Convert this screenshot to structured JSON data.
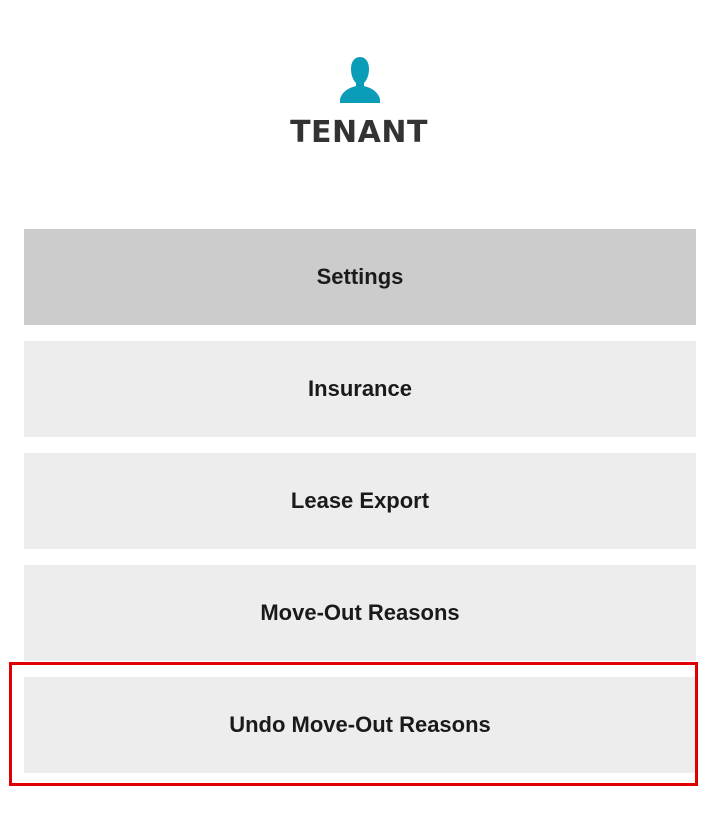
{
  "header": {
    "icon": "user-icon",
    "icon_color": "#0b9cb8",
    "title": "TENANT"
  },
  "menu": {
    "items": [
      {
        "label": "Settings",
        "active": true
      },
      {
        "label": "Insurance",
        "active": false
      },
      {
        "label": "Lease Export",
        "active": false
      },
      {
        "label": "Move-Out Reasons",
        "active": false
      },
      {
        "label": "Undo Move-Out Reasons",
        "active": false
      }
    ]
  },
  "highlight": {
    "target": "Undo Move-Out Reasons",
    "color": "#e00000"
  },
  "colors": {
    "active_item_bg": "#cccccc",
    "item_bg": "#ededed",
    "title_text": "#333333"
  }
}
